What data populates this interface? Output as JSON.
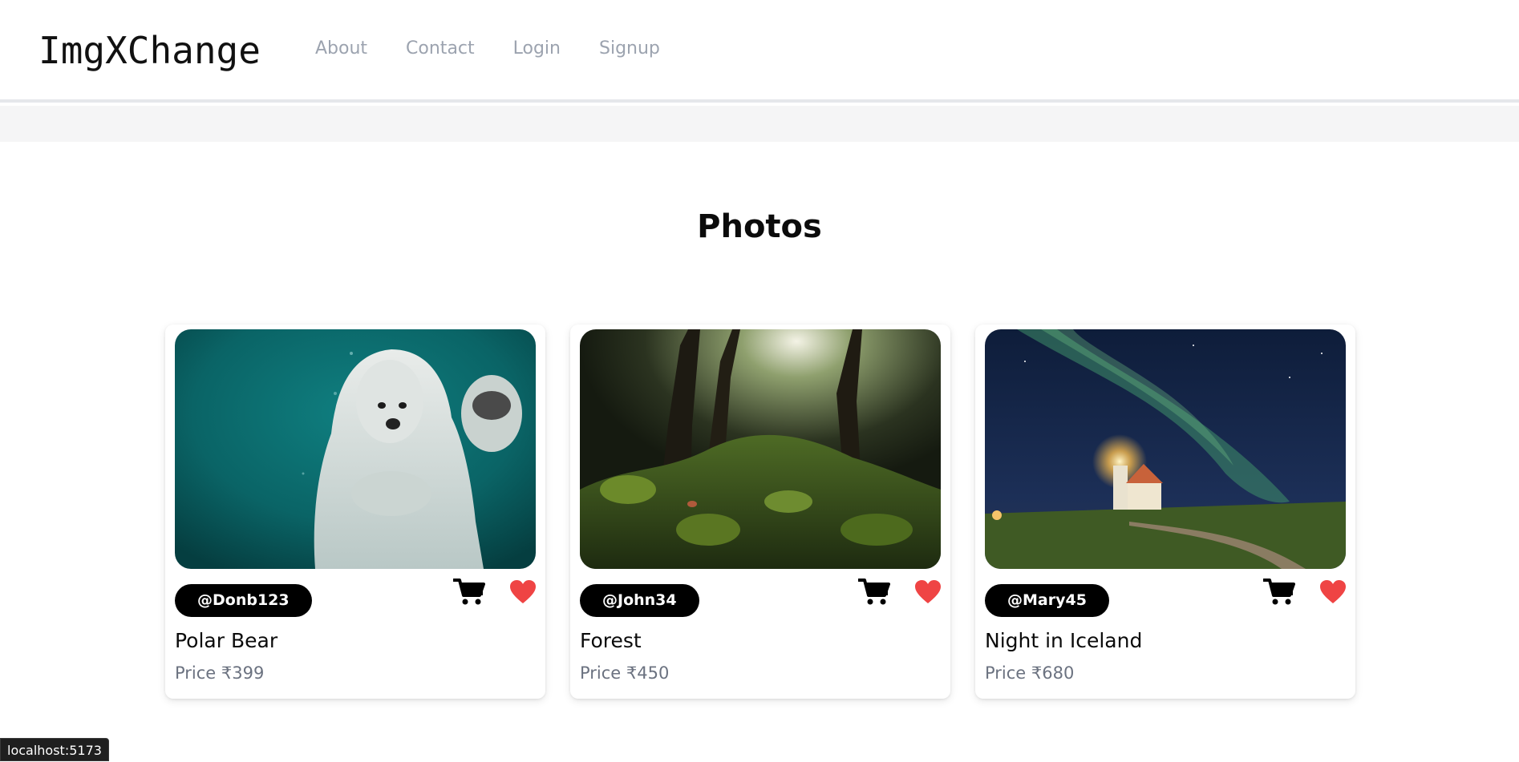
{
  "navbar": {
    "brand": "ImgXChange",
    "links": [
      {
        "label": "About"
      },
      {
        "label": "Contact"
      },
      {
        "label": "Login"
      },
      {
        "label": "Signup"
      }
    ]
  },
  "main": {
    "title": "Photos",
    "photos": [
      {
        "username": "@Donb123",
        "title": "Polar Bear",
        "price": "Price ₹399",
        "image": "polar-bear-underwater"
      },
      {
        "username": "@John34",
        "title": "Forest",
        "price": "Price ₹450",
        "image": "mossy-forest"
      },
      {
        "username": "@Mary45",
        "title": "Night in Iceland",
        "price": "Price ₹680",
        "image": "lighthouse-aurora"
      }
    ],
    "icons": {
      "cart": "cart-icon",
      "like": "heart-icon"
    },
    "colors": {
      "heart": "#ef4444",
      "badge_bg": "#000000"
    }
  },
  "status_bar": {
    "url": "localhost:5173"
  }
}
